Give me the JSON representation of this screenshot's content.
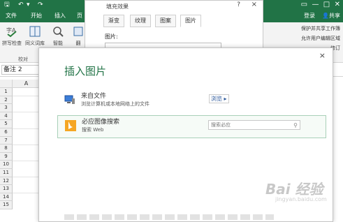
{
  "tabs": [
    "文件",
    "开始",
    "插入",
    "页"
  ],
  "login_label": "登录",
  "share_label": "共享",
  "ribbon": {
    "buttons": [
      "拼写检查",
      "同义词库",
      "智能",
      "翻"
    ],
    "group_label": "校对",
    "right_lines": [
      "保护并共享工作簿",
      "允许用户编辑区域",
      "修订"
    ]
  },
  "name_box": "备注 2",
  "grid": {
    "column": "A",
    "rows": [
      "1",
      "2",
      "3",
      "4",
      "5",
      "6",
      "7",
      "8",
      "9",
      "10",
      "11",
      "12",
      "13",
      "14",
      "15"
    ]
  },
  "fill_dialog": {
    "title": "填充效果",
    "help": "?",
    "close": "×",
    "tabs": [
      "渐变",
      "纹理",
      "图案",
      "图片"
    ],
    "active_tab": "图片",
    "picture_label": "图片:"
  },
  "insert_dialog": {
    "title": "插入图片",
    "close": "×",
    "from_file": {
      "title": "来自文件",
      "subtitle": "浏览计算机或本地网络上的文件",
      "browse": "浏览 ▸"
    },
    "bing": {
      "title": "必应图像搜索",
      "subtitle": "搜索 Web",
      "placeholder": "搜索必应"
    }
  },
  "watermark": {
    "brand": "Bai 经验",
    "sub": "jingyan.baidu.com"
  },
  "colors": {
    "excel_green": "#217346",
    "bing_orange": "#f5a623"
  }
}
